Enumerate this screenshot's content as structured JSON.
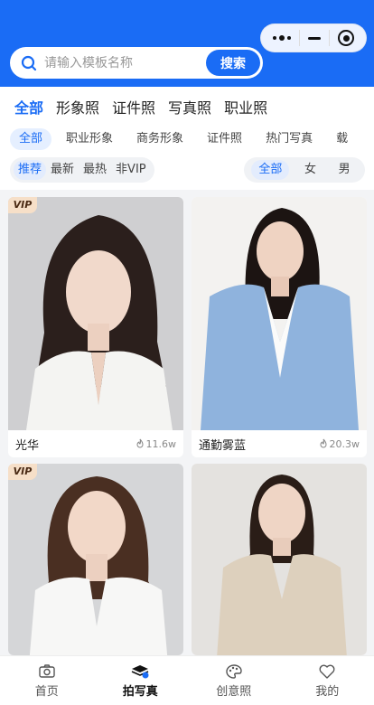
{
  "capsule": {
    "more_icon": "more-dots-icon",
    "minimize_icon": "minus-icon",
    "close_icon": "target-icon"
  },
  "search": {
    "placeholder": "请输入模板名称",
    "button_label": "搜索"
  },
  "main_tabs": [
    {
      "label": "全部",
      "active": true
    },
    {
      "label": "形象照"
    },
    {
      "label": "证件照"
    },
    {
      "label": "写真照"
    },
    {
      "label": "职业照"
    }
  ],
  "sub_tabs": [
    {
      "label": "全部",
      "active": true
    },
    {
      "label": "职业形象"
    },
    {
      "label": "商务形象"
    },
    {
      "label": "证件照"
    },
    {
      "label": "热门写真"
    },
    {
      "label": "载"
    }
  ],
  "sort": [
    {
      "label": "推荐",
      "active": true
    },
    {
      "label": "最新"
    },
    {
      "label": "最热"
    },
    {
      "label": "非VIP"
    }
  ],
  "gender": [
    {
      "label": "全部",
      "active": true
    },
    {
      "label": "女"
    },
    {
      "label": "男"
    }
  ],
  "cards": [
    {
      "title": "光华",
      "count": "11.6w",
      "vip": "VIP",
      "bg": "#cfcfd1",
      "suit": "#f4f4f2",
      "hair": "#2b1f1c"
    },
    {
      "title": "通勤雾蓝",
      "count": "20.3w",
      "vip": "",
      "bg": "#f3f2f0",
      "suit": "#8fb3dd",
      "hair": "#1c1412"
    },
    {
      "title": "",
      "count": "",
      "vip": "VIP",
      "bg": "#d5d6d8",
      "suit": "#f7f7f6",
      "hair": "#4a2f22"
    },
    {
      "title": "",
      "count": "",
      "vip": "",
      "bg": "#e4e2df",
      "suit": "#ddd0bd",
      "hair": "#2a1d17"
    }
  ],
  "tabbar": [
    {
      "label": "首页",
      "icon": "camera-icon"
    },
    {
      "label": "拍写真",
      "icon": "layers-icon",
      "active": true
    },
    {
      "label": "创意照",
      "icon": "palette-icon"
    },
    {
      "label": "我的",
      "icon": "heart-icon"
    }
  ],
  "colors": {
    "brand": "#1a6cf5",
    "vip_bg": "#f6dfc8"
  }
}
